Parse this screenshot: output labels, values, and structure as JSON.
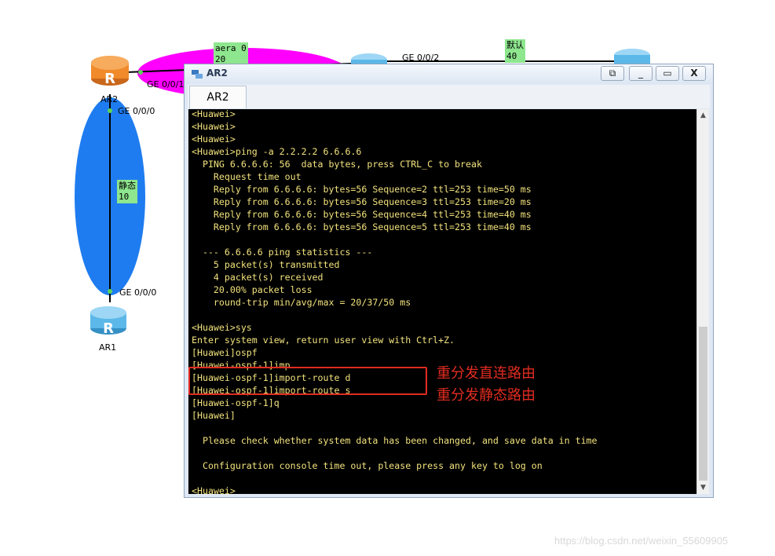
{
  "topology": {
    "routers": [
      {
        "name": "AR2"
      },
      {
        "name": "AR1"
      }
    ],
    "interfaces": {
      "ar2_ge001": "GE 0/0/1",
      "ar2_ge000": "GE 0/0/0",
      "ar1_ge000": "GE 0/0/0",
      "top_ge002": "GE 0/0/2"
    },
    "area_labels": {
      "aera0": "aera 0\n20",
      "static": "静态\n10",
      "default": "默认\n40"
    },
    "colors": {
      "magenta_area": "#ff00ff",
      "blue_area": "#1f7cf0",
      "label_bg": "#8ee68e",
      "router_orange": "#f08a2a",
      "router_blue": "#5bb8e8"
    }
  },
  "window": {
    "title": "AR2",
    "tab_label": "AR2",
    "buttons": {
      "restore": "⧉",
      "minimize": "_",
      "maximize": "▭",
      "close": "X"
    }
  },
  "console": {
    "lines": [
      "<Huawei>",
      "<Huawei>",
      "<Huawei>",
      "<Huawei>ping -a 2.2.2.2 6.6.6.6",
      "  PING 6.6.6.6: 56  data bytes, press CTRL_C to break",
      "    Request time out",
      "    Reply from 6.6.6.6: bytes=56 Sequence=2 ttl=253 time=50 ms",
      "    Reply from 6.6.6.6: bytes=56 Sequence=3 ttl=253 time=20 ms",
      "    Reply from 6.6.6.6: bytes=56 Sequence=4 ttl=253 time=40 ms",
      "    Reply from 6.6.6.6: bytes=56 Sequence=5 ttl=253 time=40 ms",
      "",
      "  --- 6.6.6.6 ping statistics ---",
      "    5 packet(s) transmitted",
      "    4 packet(s) received",
      "    20.00% packet loss",
      "    round-trip min/avg/max = 20/37/50 ms",
      "",
      "<Huawei>sys",
      "Enter system view, return user view with Ctrl+Z.",
      "[Huawei]ospf",
      "[Huawei-ospf-1]imp",
      "[Huawei-ospf-1]import-route d",
      "[Huawei-ospf-1]import-route s",
      "[Huawei-ospf-1]q",
      "[Huawei]",
      "",
      "  Please check whether system data has been changed, and save data in time",
      "",
      "  Configuration console time out, please press any key to log on",
      "",
      "<Huawei>"
    ]
  },
  "annotation": {
    "line1": "重分发直连路由",
    "line2": "重分发静态路由",
    "color": "#e02c20"
  },
  "watermark": "https://blog.csdn.net/weixin_55609905"
}
